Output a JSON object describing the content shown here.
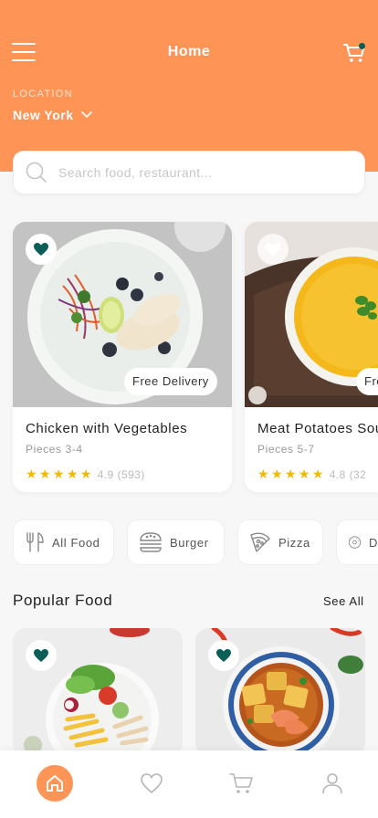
{
  "header": {
    "title": "Home",
    "location_label": "LOCATION",
    "location_value": "New York"
  },
  "search": {
    "placeholder": "Search food, restaurant..."
  },
  "featured": [
    {
      "name": "Chicken with Vegetables",
      "pieces": "Pieces 3-4",
      "rating": "4.9",
      "reviews": "(593)",
      "badge": "Free Delivery",
      "favorited": true
    },
    {
      "name": "Meat Potatoes Soup",
      "pieces": "Pieces 5-7",
      "rating": "4.8",
      "reviews": "(32",
      "badge": "Free Delivery",
      "favorited": false
    }
  ],
  "categories": [
    {
      "label": "All Food",
      "icon": "fork-knife-icon"
    },
    {
      "label": "Burger",
      "icon": "burger-icon"
    },
    {
      "label": "Pizza",
      "icon": "pizza-icon"
    },
    {
      "label": "D",
      "icon": "donut-icon"
    }
  ],
  "popular": {
    "title": "Popular Food",
    "see_all": "See All"
  },
  "bottom_nav": [
    "home-icon",
    "heart-icon",
    "cart-icon",
    "user-icon"
  ],
  "colors": {
    "accent": "#ff9457",
    "brand_dark": "#0b5e57",
    "star": "#f5b800"
  }
}
